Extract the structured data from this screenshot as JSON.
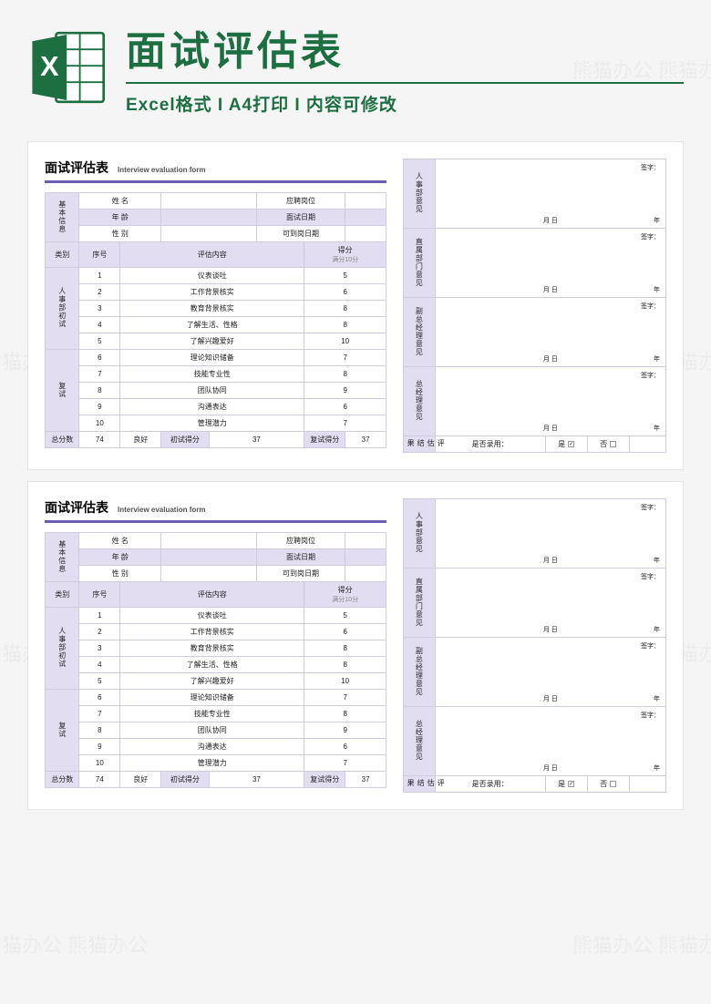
{
  "watermark": "熊猫办公 熊猫办公",
  "header": {
    "title": "面试评估表",
    "subtitle": "Excel格式 I A4打印 I 内容可修改"
  },
  "form": {
    "title_zh": "面试评估表",
    "title_en": "Interview evaluation form",
    "basic_info_label": "基本信息",
    "labels": {
      "name": "姓    名",
      "position": "应聘岗位",
      "age": "年    龄",
      "interview_date": "面试日期",
      "gender": "性    别",
      "start_date": "可到岗日期",
      "category": "类别",
      "seq": "序号",
      "eval_content": "评估内容",
      "score": "得分",
      "score_hint": "满分10分",
      "hr_first": "人事部初试",
      "second": "复试",
      "total_label": "总分数",
      "first_score": "初试得分",
      "second_score": "复试得分"
    },
    "rows": [
      {
        "n": "1",
        "content": "仪表谈吐",
        "score": "5"
      },
      {
        "n": "2",
        "content": "工作背景核实",
        "score": "6"
      },
      {
        "n": "3",
        "content": "教育背景核实",
        "score": "8"
      },
      {
        "n": "4",
        "content": "了解生活、性格",
        "score": "8"
      },
      {
        "n": "5",
        "content": "了解兴趣爱好",
        "score": "10"
      },
      {
        "n": "6",
        "content": "理论知识储备",
        "score": "7"
      },
      {
        "n": "7",
        "content": "技能专业性",
        "score": "8"
      },
      {
        "n": "8",
        "content": "团队协同",
        "score": "9"
      },
      {
        "n": "9",
        "content": "沟通表达",
        "score": "6"
      },
      {
        "n": "10",
        "content": "管理潜力",
        "score": "7"
      }
    ],
    "totals": {
      "total": "74",
      "rating": "良好",
      "first": "37",
      "second": "37"
    },
    "opinions": {
      "hr": "人事部意见",
      "dept": "直属部门意见",
      "vp": "副总经理意见",
      "gm": "总经理意见",
      "sign": "签字：",
      "md": "月    日",
      "year": "年",
      "result_label": "评估结果",
      "hire_q": "是否录用：",
      "yes": "是",
      "no": "否"
    }
  }
}
